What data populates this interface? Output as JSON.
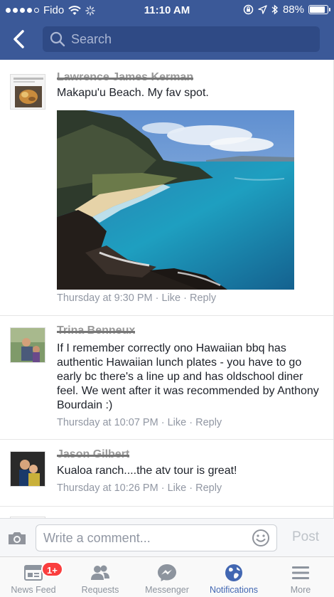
{
  "status_bar": {
    "carrier": "Fido",
    "time": "11:10 AM",
    "battery_percent": "88%",
    "battery_level": 0.88
  },
  "header": {
    "search_placeholder": "Search"
  },
  "comments": [
    {
      "name": "Lawrence James Kerman",
      "text": "Makapu'u Beach. My fav spot.",
      "time": "Thursday at 9:30 PM",
      "like": "Like",
      "reply": "Reply",
      "separator": "·"
    },
    {
      "name": "Trina Benneux",
      "text": "If I remember correctly ono Hawaiian bbq has authentic Hawaiian lunch plates - you have to go early bc there's a line up and has oldschool diner feel. We went after it was recommended by Anthony Bourdain :)",
      "time": "Thursday at 10:07 PM",
      "like": "Like",
      "reply": "Reply",
      "separator": "·"
    },
    {
      "name": "Jason Gilbert",
      "text": "Kualoa ranch....the atv tour is great!",
      "time": "Thursday at 10:26 PM",
      "like": "Like",
      "reply": "Reply",
      "separator": "·"
    }
  ],
  "composer": {
    "placeholder": "Write a comment...",
    "post_label": "Post"
  },
  "tabs": [
    {
      "label": "News Feed",
      "badge": "1+",
      "icon": "news-feed-icon"
    },
    {
      "label": "Requests",
      "icon": "friend-requests-icon"
    },
    {
      "label": "Messenger",
      "icon": "messenger-icon"
    },
    {
      "label": "Notifications",
      "icon": "globe-icon",
      "active": true
    },
    {
      "label": "More",
      "icon": "menu-icon"
    }
  ],
  "colors": {
    "brand": "#3b5998",
    "active_tab": "#4267b2",
    "badge": "#fa3e3e"
  }
}
